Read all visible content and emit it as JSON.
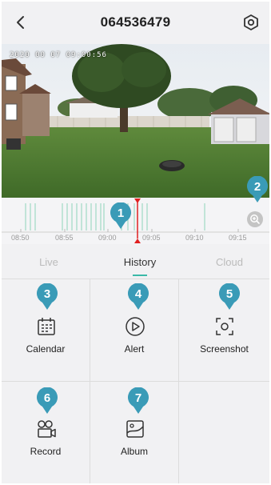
{
  "header": {
    "title": "064536479",
    "back_icon": "chevron-left-icon",
    "settings_icon": "hexagon-gear-icon"
  },
  "video": {
    "timestamp": "2020 00 07 09:00:56"
  },
  "timeline": {
    "ticks": [
      "08:50",
      "08:55",
      "09:00",
      "09:05",
      "09:10",
      "09:15"
    ],
    "zoom_icon": "zoom-in-icon",
    "marker_color": "#e02020",
    "record_color": "#a6dcc9"
  },
  "tabs": {
    "live": "Live",
    "history": "History",
    "cloud": "Cloud",
    "active": "History"
  },
  "features": {
    "calendar": "Calendar",
    "alert": "Alert",
    "screenshot": "Screenshot",
    "record": "Record",
    "album": "Album"
  },
  "callouts": [
    "1",
    "2",
    "3",
    "4",
    "5",
    "6",
    "7"
  ],
  "colors": {
    "accent": "#3bb9a8",
    "callout": "#3a9bb7"
  }
}
